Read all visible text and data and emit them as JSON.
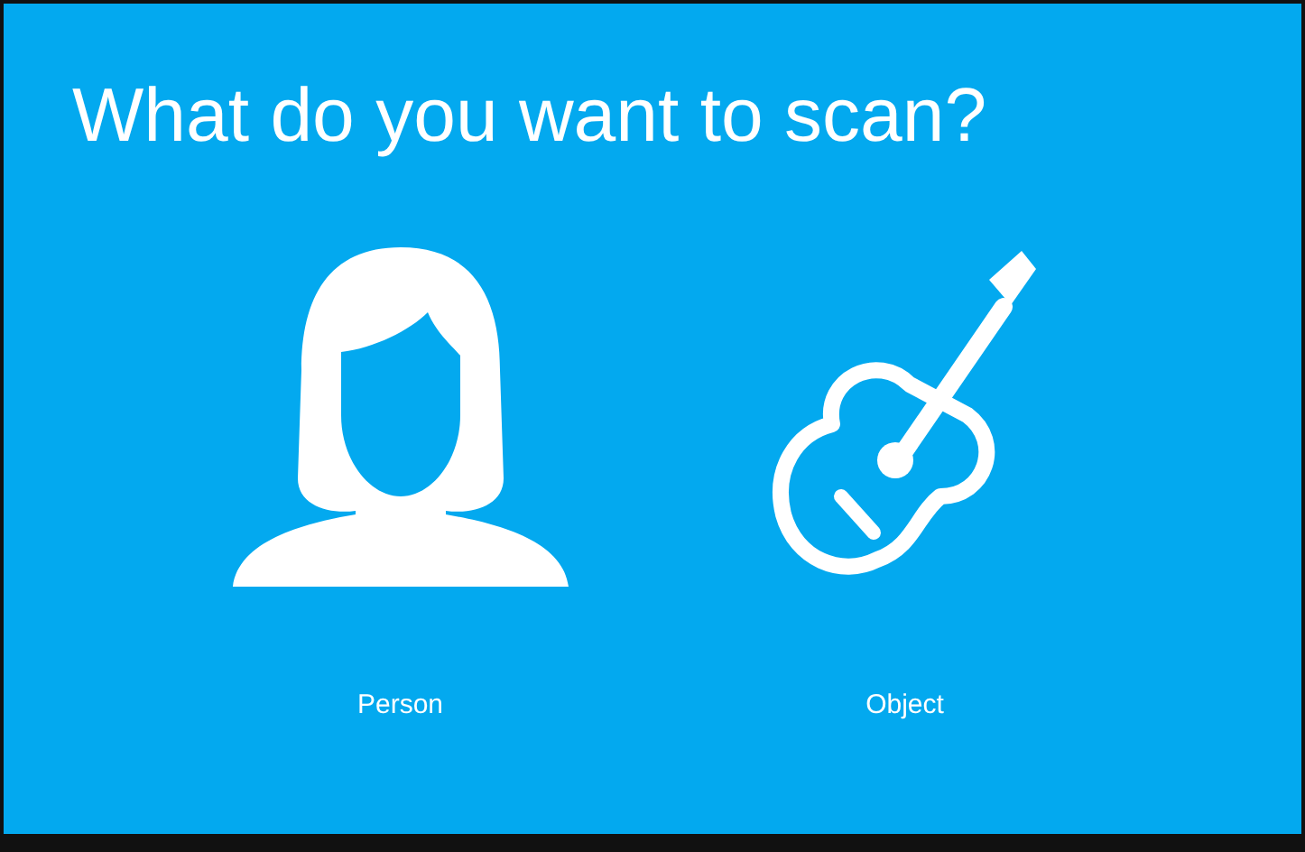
{
  "title": "What do you want to scan?",
  "options": [
    {
      "kind": "person",
      "label": "Person"
    },
    {
      "kind": "object",
      "label": "Object"
    }
  ]
}
